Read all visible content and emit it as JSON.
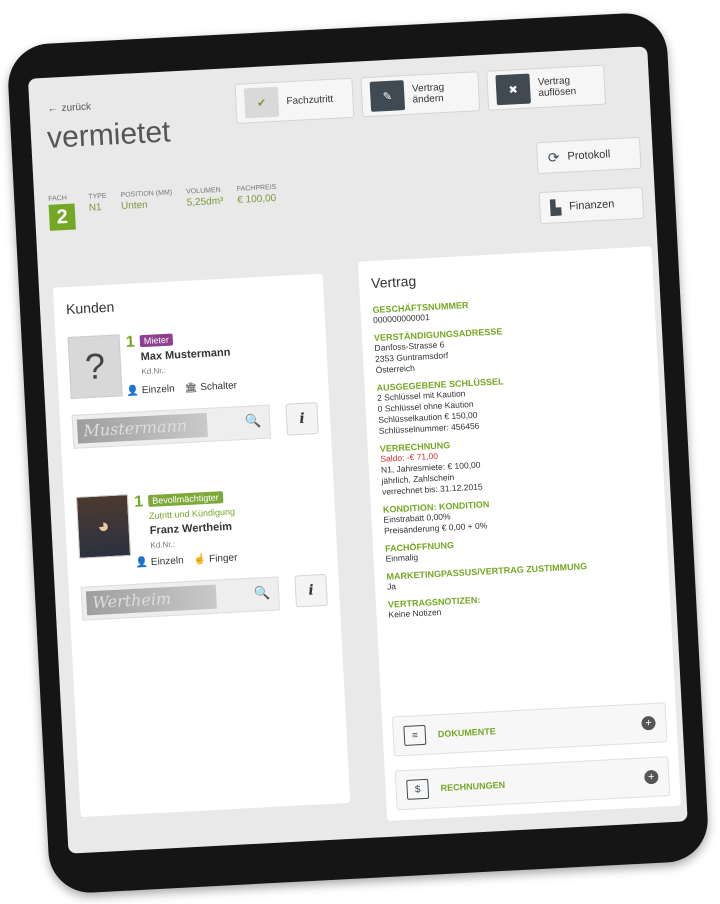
{
  "header": {
    "back_label": "zurück",
    "title": "vermietet"
  },
  "toolbar": {
    "fachzutritt": "Fachzutritt",
    "vertrag_aendern": "Vertrag ändern",
    "vertrag_aufloesen": "Vertrag auflösen",
    "protokoll": "Protokoll",
    "finanzen": "Finanzen"
  },
  "stats": {
    "fach_label": "FACH",
    "fach_value": "2",
    "type_label": "TYPE",
    "type_value": "N1",
    "position_label": "POSITION (MM)",
    "position_value": "Unten",
    "volumen_label": "VOLUMEN",
    "volumen_value": "5,25dm³",
    "fachpreis_label": "FACHPREIS",
    "fachpreis_value": "€ 100,00"
  },
  "kunden": {
    "title": "Kunden",
    "customers": [
      {
        "number": "1",
        "role": "Mieter",
        "role_desc": "",
        "name": "Max Mustermann",
        "kdnr": "Kd.Nr.:",
        "auth1": "Einzeln",
        "auth2": "Schalter",
        "signature": "Mustermann"
      },
      {
        "number": "1",
        "role": "Bevollmächtigter",
        "role_desc": "Zutritt und Kündigung",
        "name": "Franz Wertheim",
        "kdnr": "Kd.Nr.:",
        "auth1": "Einzeln",
        "auth2": "Finger",
        "signature": "Wertheim"
      }
    ]
  },
  "vertrag": {
    "title": "Vertrag",
    "sections": [
      {
        "head": "GESCHÄFTSNUMMER",
        "lines": [
          "000000000001"
        ]
      },
      {
        "head": "VERSTÄNDIGUNGSADRESSE",
        "lines": [
          "Danfoss-Strasse 6",
          "2353 Guntramsdorf",
          "Österreich"
        ]
      },
      {
        "head": "AUSGEGEBENE SCHLÜSSEL",
        "lines": [
          "2 Schlüssel mit Kaution",
          "0 Schlüssel ohne Kaution",
          "Schlüsselkaution € 150,00",
          "Schlüsselnummer: 456456"
        ]
      },
      {
        "head": "VERRECHNUNG",
        "lines": [
          "Saldo: -€ 71,00",
          "N1, Jahresmiete: € 100,00",
          "jährlich, Zahlschein",
          "verrechnet bis: 31.12.2015"
        ]
      },
      {
        "head": "KONDITION: KONDITION",
        "lines": [
          "Einstrabatt 0,00%",
          "Preisänderung € 0,00 + 0%"
        ]
      },
      {
        "head": "FACHÖFFNUNG",
        "lines": [
          "Einmalig"
        ]
      },
      {
        "head": "MARKETINGPASSUS/VERTRAG ZUSTIMMUNG",
        "lines": [
          "Ja"
        ]
      },
      {
        "head": "VERTRAGSNOTIZEN:",
        "lines": [
          "Keine Notizen"
        ]
      }
    ],
    "dokumente": "DOKUMENTE",
    "rechnungen": "RECHNUNGEN"
  },
  "colors": {
    "accent_green": "#74a824",
    "mieter_badge": "#8e3f8f",
    "saldo_negative": "#d03030"
  }
}
